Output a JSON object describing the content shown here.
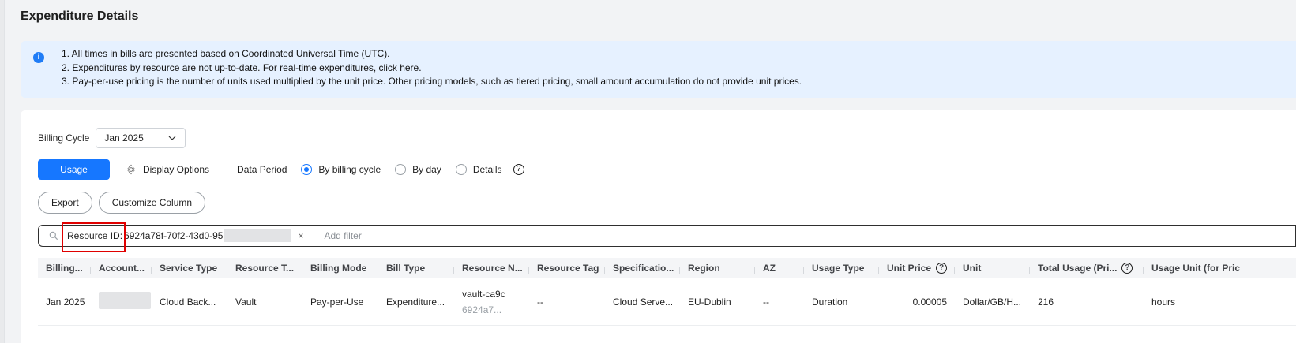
{
  "page": {
    "title": "Expenditure Details"
  },
  "info": {
    "lines": [
      "1. All times in bills are presented based on Coordinated Universal Time (UTC).",
      "2. Expenditures by resource are not up-to-date. For real-time expenditures, click here.",
      "3. Pay-per-use pricing is the number of units used multiplied by the unit price. Other pricing models, such as tiered pricing, small amount accumulation do not provide unit prices."
    ]
  },
  "billing": {
    "label": "Billing Cycle",
    "selected": "Jan 2025"
  },
  "controls": {
    "usage_label": "Usage",
    "display_options": "Display Options",
    "data_period_label": "Data Period",
    "radios": [
      {
        "label": "By billing cycle",
        "selected": true
      },
      {
        "label": "By day",
        "selected": false
      },
      {
        "label": "Details",
        "selected": false
      }
    ],
    "help": "?"
  },
  "actions": {
    "export": "Export",
    "customize": "Customize Column"
  },
  "filter": {
    "key": "Resource ID:",
    "value_prefix": "6924a78f-70f2-43d0-95",
    "clear": "×",
    "add_filter_placeholder": "Add filter"
  },
  "table": {
    "headers": [
      "Billing...",
      "Account...",
      "Service Type",
      "Resource T...",
      "Billing Mode",
      "Bill Type",
      "Resource N...",
      "Resource Tag",
      "Specificatio...",
      "Region",
      "AZ",
      "Usage Type",
      "Unit Price",
      "Unit",
      "Total Usage (Pri...",
      "Usage Unit (for Pric"
    ],
    "rows": [
      {
        "billing": "Jan 2025",
        "service_type": "Cloud Back...",
        "resource_type": "Vault",
        "billing_mode": "Pay-per-Use",
        "bill_type": "Expenditure...",
        "resource_name": "vault-ca9c",
        "resource_name_sub": "6924a7...",
        "resource_tag": "--",
        "specification": "Cloud Serve...",
        "region": "EU-Dublin",
        "az": "--",
        "usage_type": "Duration",
        "unit_price": "0.00005",
        "unit": "Dollar/GB/H...",
        "total_usage": "216",
        "usage_unit": "hours"
      }
    ]
  },
  "colors": {
    "primary": "#1677ff",
    "info_bg": "#e6f1ff",
    "highlight": "#e00000"
  }
}
